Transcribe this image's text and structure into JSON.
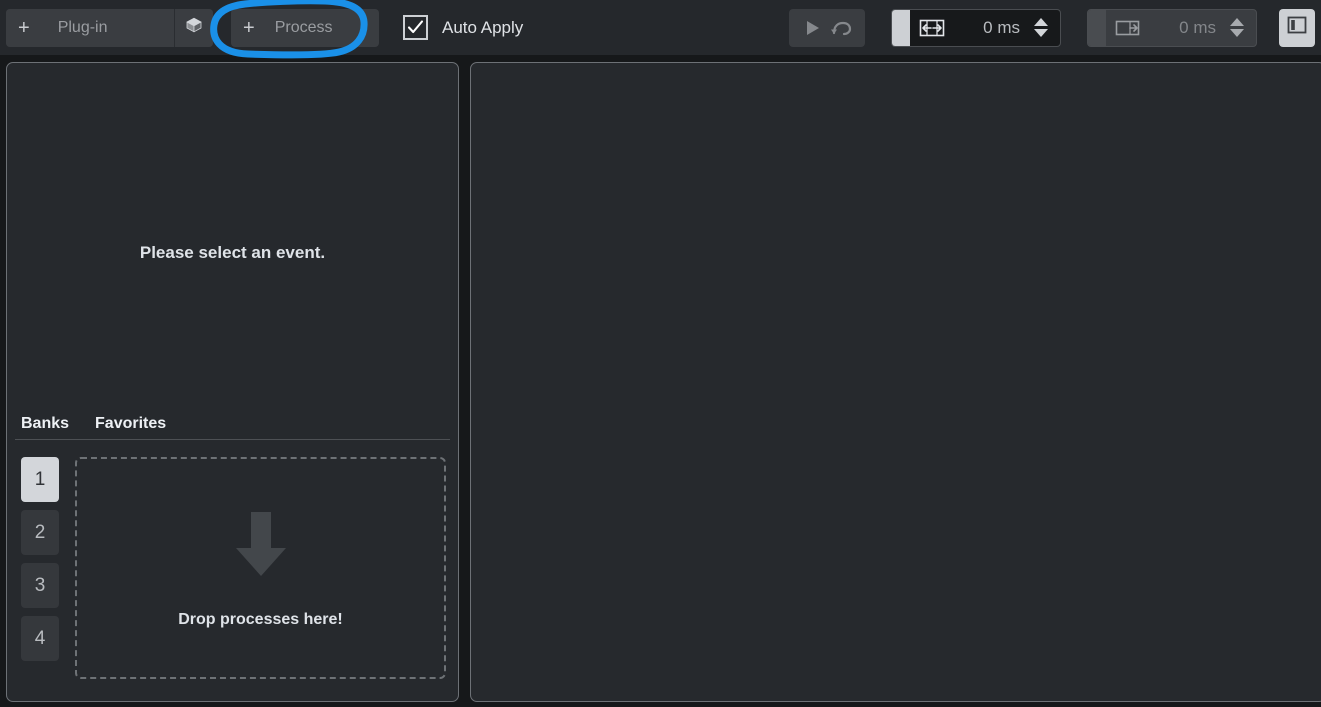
{
  "toolbar": {
    "plugin_button": {
      "plus": "+",
      "label": "Plug-in",
      "icon": "cube-icon"
    },
    "process_button": {
      "plus": "+",
      "label": "Process"
    },
    "auto_apply": {
      "label": "Auto Apply",
      "checked": true,
      "check_glyph": "✓"
    },
    "transport": {
      "play_icon": "play-icon",
      "loop_icon": "loop-icon"
    },
    "fade_field": {
      "icon": "fade-both-icon",
      "value": "0 ms",
      "active": true
    },
    "tail_field": {
      "icon": "tail-right-icon",
      "value": "0 ms",
      "active": false
    },
    "panel_toggle": {
      "icon": "left-panel-icon",
      "active": true
    }
  },
  "annotation": {
    "color": "#1a90e8",
    "shape": "hand-drawn-ellipse",
    "target": "Process"
  },
  "left_panel": {
    "message": "Please select an event.",
    "tabs": [
      {
        "label": "Banks",
        "selected": true
      },
      {
        "label": "Favorites",
        "selected": false
      }
    ],
    "banks": [
      {
        "label": "1",
        "selected": true
      },
      {
        "label": "2",
        "selected": false
      },
      {
        "label": "3",
        "selected": false
      },
      {
        "label": "4",
        "selected": false
      }
    ],
    "dropzone": {
      "label": "Drop processes here!",
      "icon": "down-arrow-icon"
    }
  },
  "right_panel": {
    "content": ""
  },
  "colors": {
    "background": "#16181a",
    "toolbar_bg": "#25282c",
    "panel_bg": "#26292d",
    "panel_border": "#6d7176",
    "button_bg": "#3a3d41",
    "text_primary": "#dfe3e8",
    "text_muted": "#9a9da1",
    "accent_light": "#cdd0d4",
    "annotation_blue": "#1a90e8"
  }
}
